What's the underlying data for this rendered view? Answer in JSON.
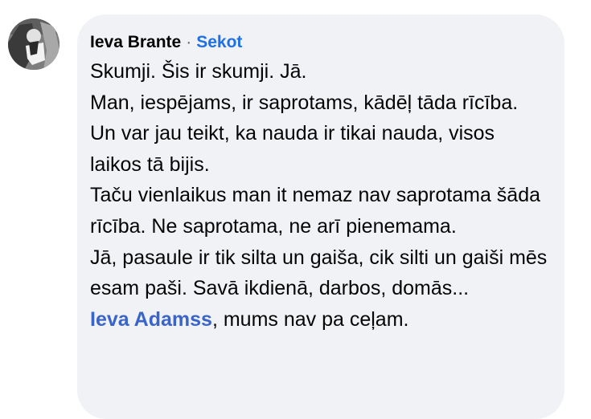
{
  "comment": {
    "author": "Ieva Brante",
    "separator": "·",
    "follow_label": "Sekot",
    "paragraphs": [
      "Skumji. Šis ir skumji. Jā.",
      "Man, iespējams, ir saprotams, kādēļ tāda rīcība. Un var jau teikt, ka nauda ir tikai nauda, visos laikos tā bijis.",
      "Taču vienlaikus man it nemaz nav saprotama šāda rīcība. Ne saprotama, ne arī pienemama.",
      "Jā, pasaule ir tik silta un gaiša, cik silti un gaiši mēs esam paši. Savā ikdienā, darbos, domās..."
    ],
    "mention": "Ieva Adamss",
    "mention_suffix": ", mums nav pa ceļam."
  },
  "colors": {
    "bubble_bg": "#f0f2f5",
    "link_blue": "#1f6fe5",
    "text": "#050505"
  }
}
